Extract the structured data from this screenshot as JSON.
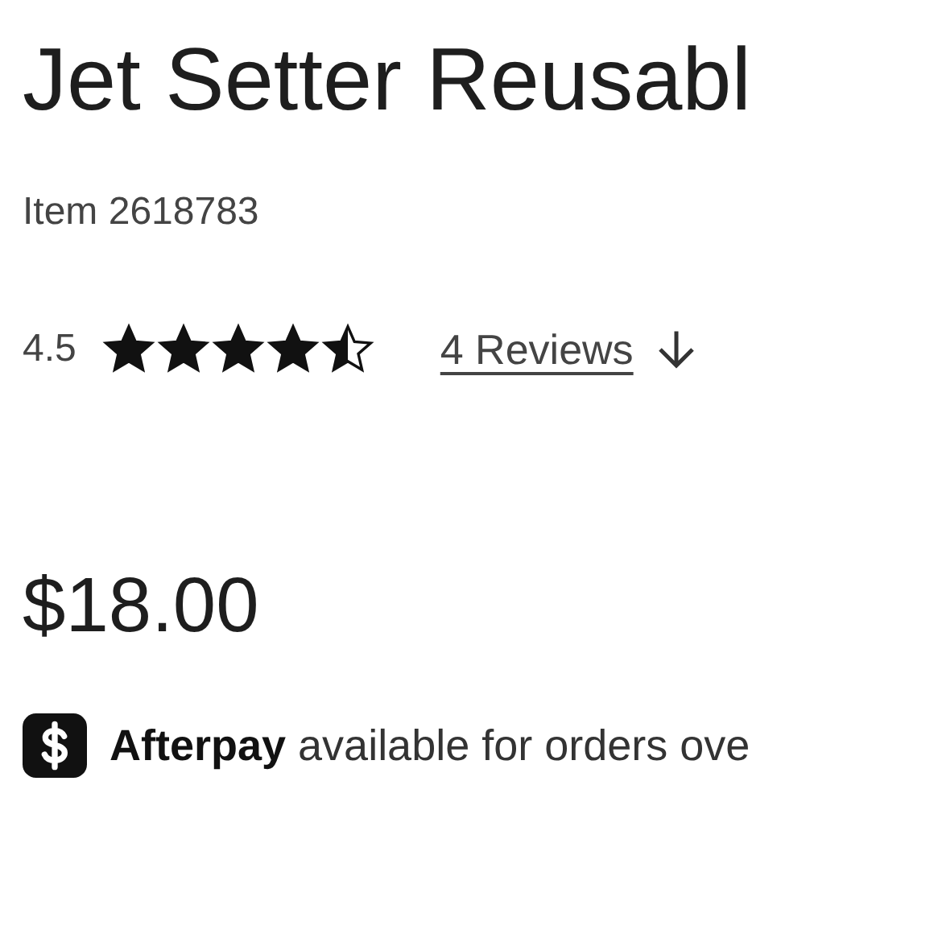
{
  "product": {
    "title": "Jet Setter Reusabl",
    "item_number": "Item 2618783",
    "rating": "4.5",
    "stars": 4.5,
    "reviews_link": "4 Reviews",
    "price": "$18.00",
    "afterpay_note": "**Afterpay** available for orders ove"
  }
}
